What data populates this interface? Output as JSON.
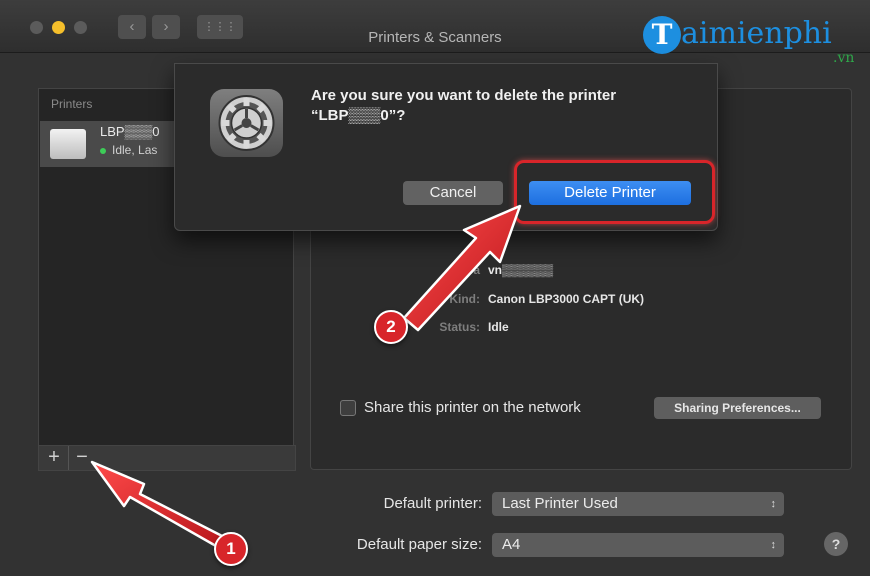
{
  "window": {
    "title": "Printers & Scanners",
    "colors": {
      "close": "#5b5b5b",
      "minimize": "#f5bf2b",
      "zoom": "#5b5b5b"
    },
    "nav": {
      "back_icon": "‹",
      "forward_icon": "›",
      "grid_icon": "⋮⋮⋮"
    }
  },
  "watermark": {
    "brand_letter": "T",
    "brand_text": "aimienphi",
    "brand_suffix": ".vn"
  },
  "sidebar": {
    "header": "Printers",
    "printers": [
      {
        "name": "LBP▒▒▒0",
        "status": "Idle, Las"
      }
    ],
    "add_label": "+",
    "remove_label": "−"
  },
  "details": {
    "location_label": "Loca",
    "location_value": "vn▒▒▒▒▒▒",
    "kind_label": "Kind:",
    "kind_value": "Canon LBP3000 CAPT (UK)",
    "status_label": "Status:",
    "status_value": "Idle",
    "share_label": "Share this printer on the network",
    "share_button": "Sharing Preferences..."
  },
  "footer": {
    "default_printer_label": "Default printer:",
    "default_printer_value": "Last Printer Used",
    "paper_size_label": "Default paper size:",
    "paper_size_value": "A4",
    "help_label": "?"
  },
  "dialog": {
    "message_line1": "Are you sure you want to delete the printer",
    "message_line2": "“LBP▒▒▒0”?",
    "cancel_label": "Cancel",
    "delete_label": "Delete Printer"
  },
  "annotations": {
    "step1": "1",
    "step2": "2",
    "color": "#d8252a"
  }
}
